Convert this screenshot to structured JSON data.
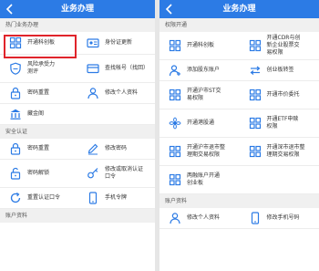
{
  "left": {
    "title": "业务办理",
    "sections": [
      {
        "header": "热门业务办理",
        "rows": [
          {
            "items": [
              {
                "label": "开通科创板",
                "icon": "grid-icon"
              },
              {
                "label": "身份证更新",
                "icon": "id-card-icon"
              }
            ]
          },
          {
            "items": [
              {
                "label": "风险承受力\n测评",
                "icon": "shield-icon"
              },
              {
                "label": "查找帐号（找回）",
                "icon": "card-icon"
              }
            ]
          },
          {
            "items": [
              {
                "label": "密码重置",
                "icon": "lock-icon"
              },
              {
                "label": "修改个人资料",
                "icon": "person-icon"
              }
            ]
          },
          {
            "items": [
              {
                "label": "藏金阁",
                "icon": "bank-icon"
              }
            ]
          }
        ]
      },
      {
        "header": "安全认证",
        "rows": [
          {
            "items": [
              {
                "label": "密码重置",
                "icon": "lock-icon"
              },
              {
                "label": "修改密码",
                "icon": "pencil-icon"
              }
            ]
          },
          {
            "items": [
              {
                "label": "密码解锁",
                "icon": "unlock-icon"
              },
              {
                "label": "修改或取消认证\n口令",
                "icon": "key-icon"
              }
            ]
          },
          {
            "items": [
              {
                "label": "重置认证口令",
                "icon": "refresh-icon"
              },
              {
                "label": "手机令牌",
                "icon": "phone-icon"
              }
            ]
          }
        ]
      },
      {
        "header": "账户资料",
        "rows": []
      }
    ]
  },
  "right": {
    "title": "业务办理",
    "sections": [
      {
        "header": "权限开通",
        "rows": [
          {
            "items": [
              {
                "label": "开通科创板",
                "icon": "grid-icon"
              },
              {
                "label": "开通CDR与创\n新企业股票交\n易权限",
                "icon": "grid-icon"
              }
            ]
          },
          {
            "items": [
              {
                "label": "添加股东账户",
                "icon": "add-person-icon"
              },
              {
                "label": "创业板转签",
                "icon": "exchange-icon"
              }
            ]
          },
          {
            "items": [
              {
                "label": "开通沪市ST交\n易权限",
                "icon": "grid-icon"
              },
              {
                "label": "开通市价委托",
                "icon": "grid-icon"
              }
            ]
          },
          {
            "items": [
              {
                "label": "开通港股通",
                "icon": "flower-icon"
              },
              {
                "label": "开通ETF申赎\n权限",
                "icon": "grid-icon"
              }
            ]
          },
          {
            "items": [
              {
                "label": "开通沪市退市整\n理期交易权限",
                "icon": "grid-icon"
              },
              {
                "label": "开通深市退市整\n理期交易权限",
                "icon": "grid-icon"
              }
            ]
          },
          {
            "items": [
              {
                "label": "两融账户开通\n创业板",
                "icon": "grid-icon"
              }
            ]
          }
        ]
      },
      {
        "header": "账户资料",
        "rows": [
          {
            "items": [
              {
                "label": "修改个人资料",
                "icon": "person-icon"
              },
              {
                "label": "修改手机号码",
                "icon": "phone-icon"
              }
            ]
          }
        ]
      }
    ]
  },
  "colors": {
    "topbar": "#2c7be5",
    "icon": "#2c7be5",
    "highlight": "#e0242b"
  }
}
